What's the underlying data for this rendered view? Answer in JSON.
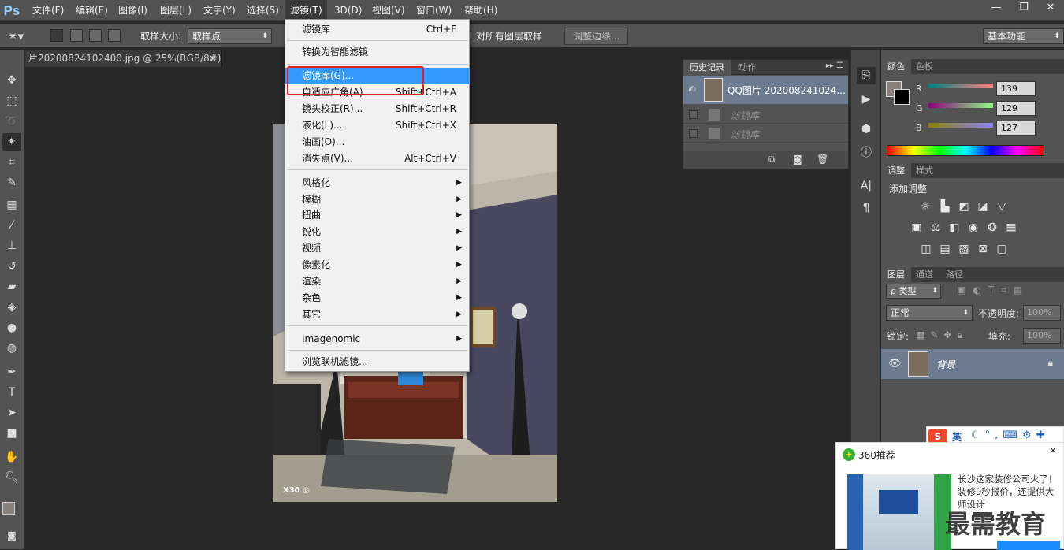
{
  "app": {
    "logo": "Ps"
  },
  "menubar": {
    "items": [
      "文件(F)",
      "编辑(E)",
      "图像(I)",
      "图层(L)",
      "文字(Y)",
      "选择(S)",
      "滤镜(T)",
      "3D(D)",
      "视图(V)",
      "窗口(W)",
      "帮助(H)"
    ]
  },
  "window_controls": {
    "minimize": "—",
    "restore": "❐",
    "close": "✕"
  },
  "options": {
    "sample_size_label": "取样大小:",
    "sample_size_value": "取样点",
    "sample_all_layers": "对所有图层取样",
    "refine_edge": "调整边缘...",
    "workspace": "基本功能"
  },
  "document": {
    "tab_title": "片20200824102400.jpg @ 25%(RGB/8#) *",
    "tab_close": "×",
    "photo_watermark": "X30 ◎"
  },
  "filter_menu": {
    "items": [
      {
        "label": "滤镜库",
        "shortcut": "Ctrl+F"
      },
      {
        "label": "转换为智能滤镜",
        "shortcut": ""
      },
      {
        "label": "滤镜库(G)...",
        "shortcut": ""
      },
      {
        "label": "自适应广角(A)...",
        "shortcut": "Shift+Ctrl+A"
      },
      {
        "label": "镜头校正(R)...",
        "shortcut": "Shift+Ctrl+R"
      },
      {
        "label": "液化(L)...",
        "shortcut": "Shift+Ctrl+X"
      },
      {
        "label": "油画(O)...",
        "shortcut": ""
      },
      {
        "label": "消失点(V)...",
        "shortcut": "Alt+Ctrl+V"
      },
      {
        "label": "风格化",
        "shortcut": ""
      },
      {
        "label": "模糊",
        "shortcut": ""
      },
      {
        "label": "扭曲",
        "shortcut": ""
      },
      {
        "label": "锐化",
        "shortcut": ""
      },
      {
        "label": "视频",
        "shortcut": ""
      },
      {
        "label": "像素化",
        "shortcut": ""
      },
      {
        "label": "渲染",
        "shortcut": ""
      },
      {
        "label": "杂色",
        "shortcut": ""
      },
      {
        "label": "其它",
        "shortcut": ""
      },
      {
        "label": "Imagenomic",
        "shortcut": ""
      },
      {
        "label": "浏览联机滤镜...",
        "shortcut": ""
      }
    ]
  },
  "history": {
    "tabs": [
      "历史记录",
      "动作"
    ],
    "snapshot": "QQ图片 202008241024...",
    "steps": [
      "滤镜库",
      "滤镜库"
    ]
  },
  "color": {
    "tabs": [
      "颜色",
      "色板"
    ],
    "r_label": "R",
    "g_label": "G",
    "b_label": "B",
    "r": "139",
    "g": "129",
    "b": "127",
    "fg_color": "#8b817f"
  },
  "adjust": {
    "tabs": [
      "调整",
      "样式"
    ],
    "add_label": "添加调整"
  },
  "layers": {
    "tabs": [
      "图层",
      "通道",
      "路径"
    ],
    "kind_filter": "ρ 类型",
    "blend_mode": "正常",
    "opacity_label": "不透明度:",
    "opacity_value": "100%",
    "lock_label": "锁定:",
    "fill_label": "填充:",
    "fill_value": "100%",
    "layer_name": "背景"
  },
  "ime": {
    "lang": "英"
  },
  "popup": {
    "title": "360推荐",
    "ad_text": "长沙这家装修公司火了！装修9秒报价，还提供大师设计",
    "watermark": "最需教育",
    "close": "✕"
  }
}
